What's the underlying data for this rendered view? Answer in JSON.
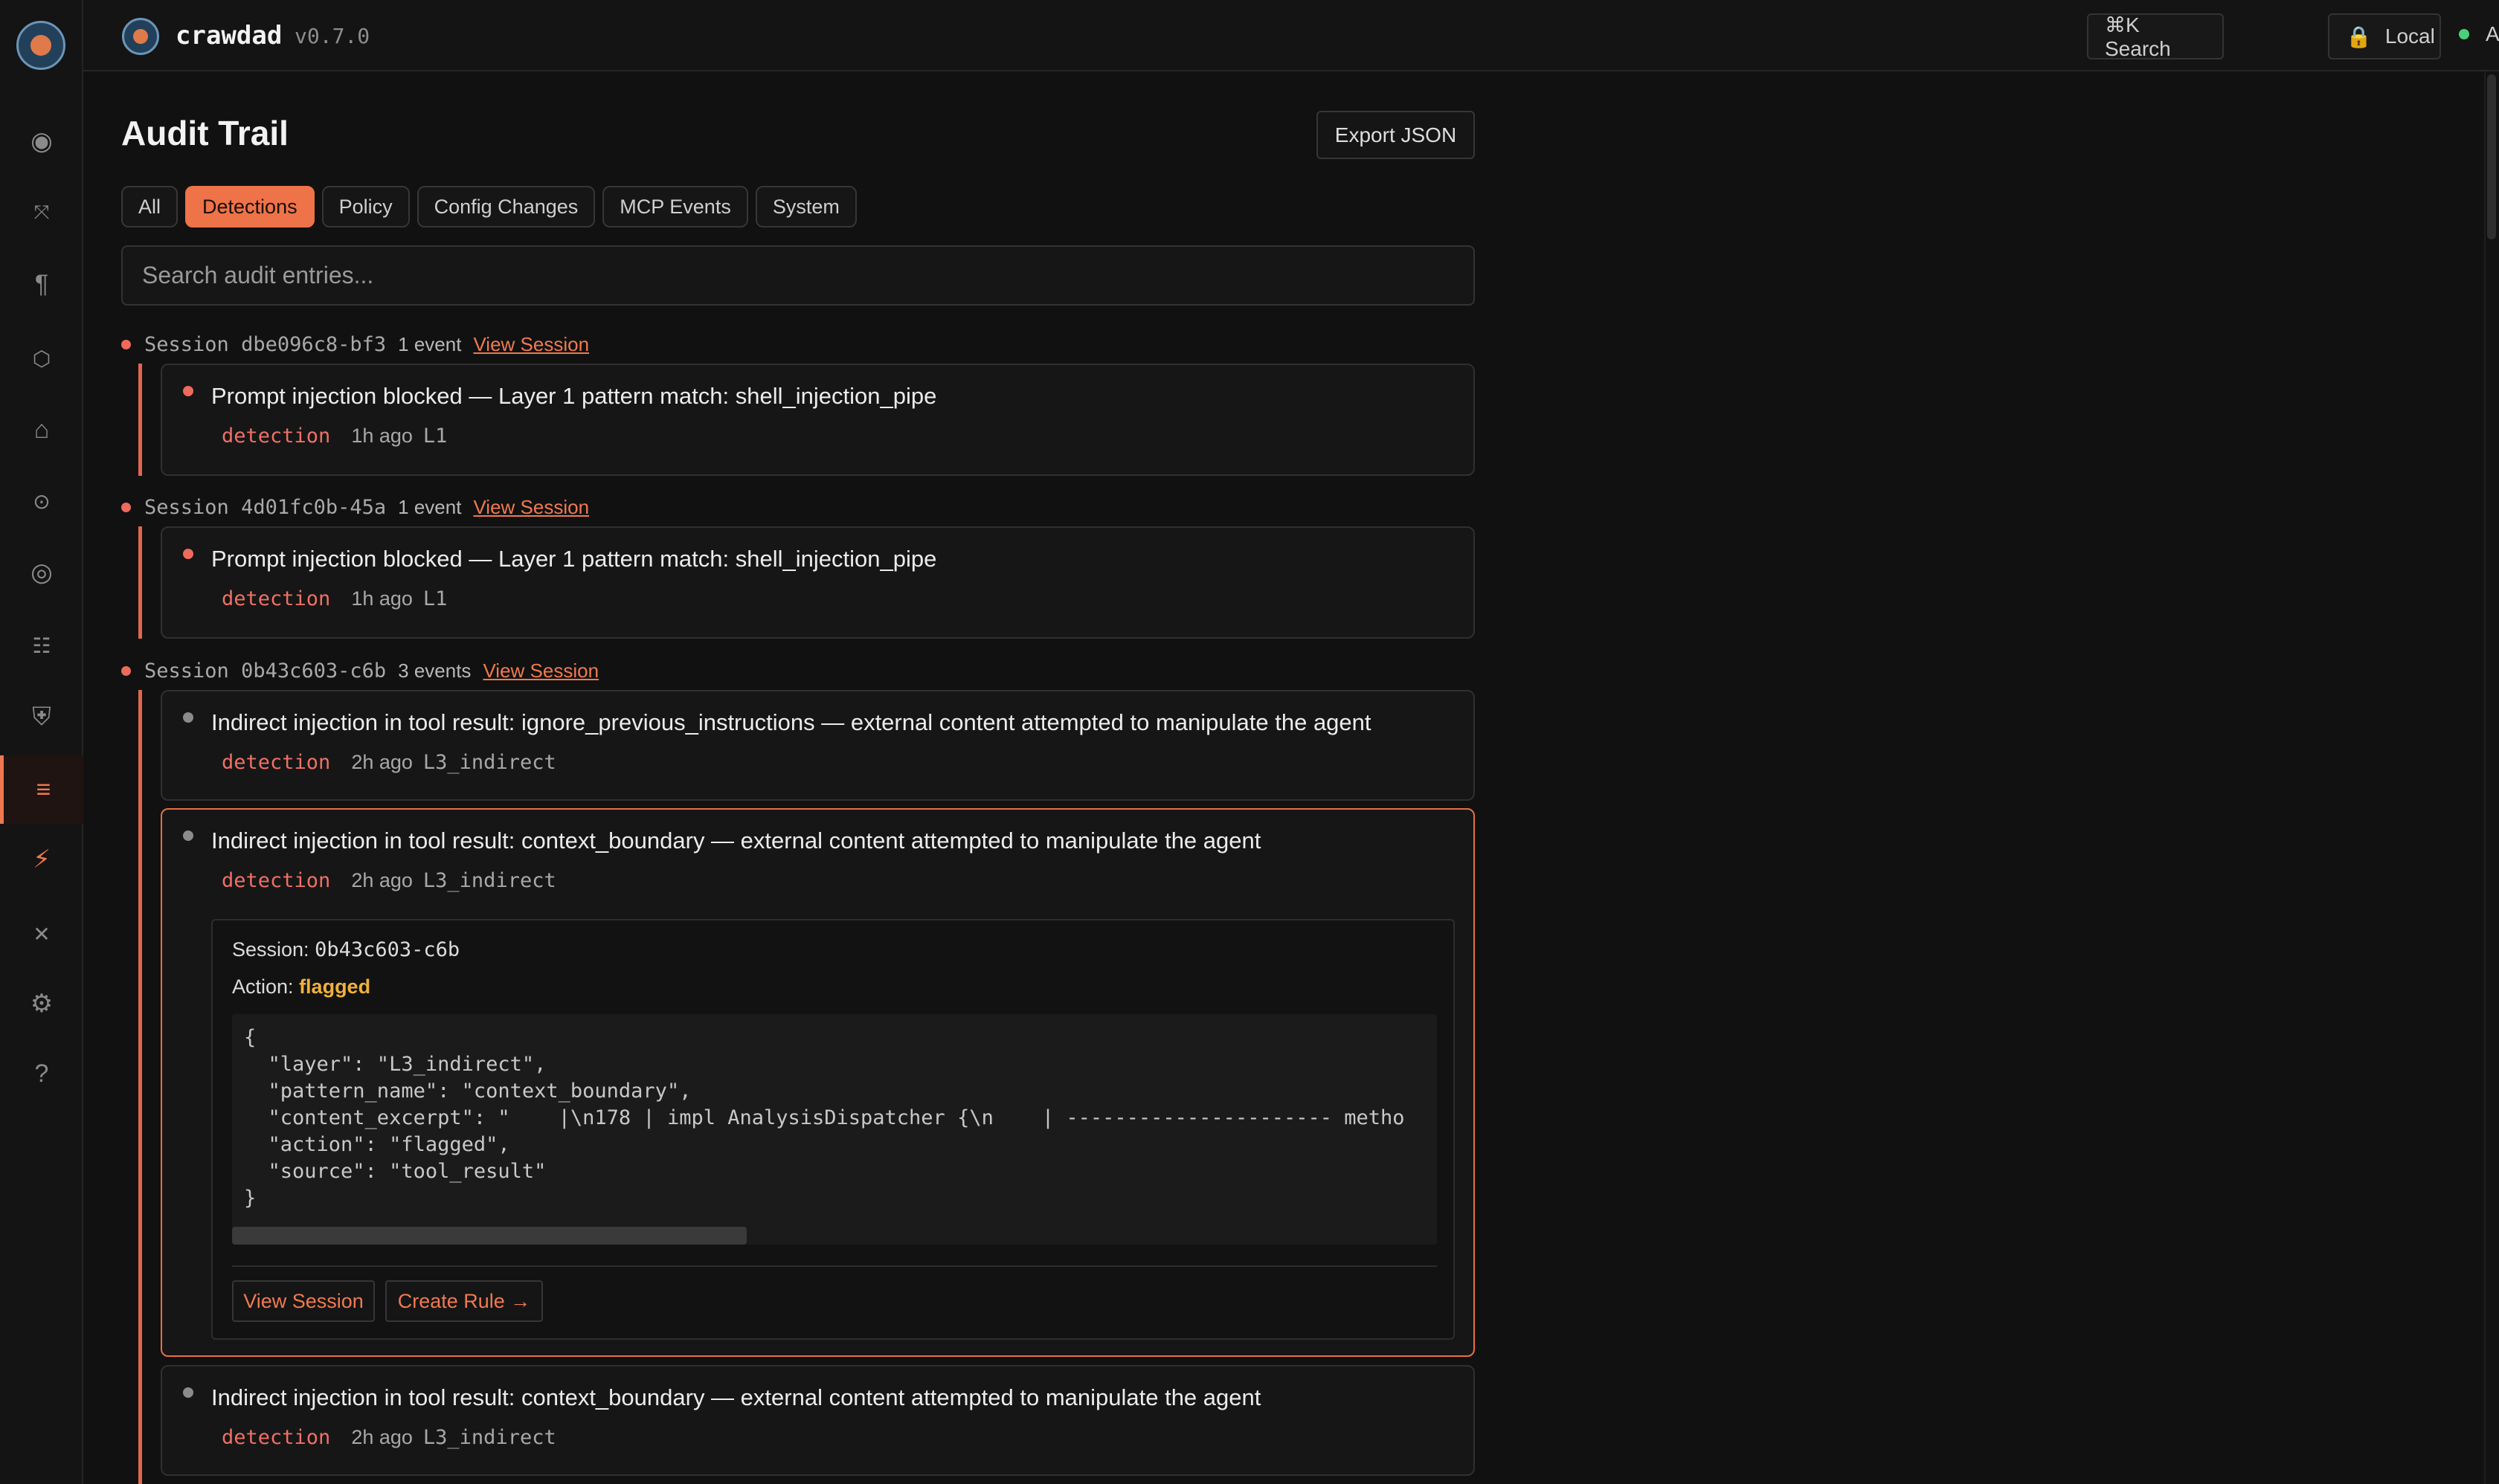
{
  "app": {
    "name": "crawdad",
    "version": "v0.7.0"
  },
  "topbar": {
    "search_label": "⌘K Search",
    "local_label": "Local",
    "status_label": "Active"
  },
  "sidebar": {
    "items": [
      {
        "name": "dashboard",
        "icon": "◉"
      },
      {
        "name": "tools",
        "icon": "⤧"
      },
      {
        "name": "rules",
        "icon": "¶"
      },
      {
        "name": "network",
        "icon": "⬡"
      },
      {
        "name": "home",
        "icon": "⌂"
      },
      {
        "name": "monitor",
        "icon": "⊙"
      },
      {
        "name": "scan",
        "icon": "◎"
      },
      {
        "name": "grid",
        "icon": "☷"
      },
      {
        "name": "shield",
        "icon": "⛨"
      },
      {
        "name": "audit",
        "icon": "≡"
      },
      {
        "name": "bolt",
        "icon": "⚡"
      },
      {
        "name": "close",
        "icon": "✕"
      },
      {
        "name": "settings",
        "icon": "⚙"
      },
      {
        "name": "help",
        "icon": "?"
      }
    ]
  },
  "page": {
    "title": "Audit Trail",
    "export_label": "Export JSON"
  },
  "tabs": [
    "All",
    "Detections",
    "Policy",
    "Config Changes",
    "MCP Events",
    "System"
  ],
  "active_tab": "Detections",
  "search": {
    "placeholder": "Search audit entries..."
  },
  "sessions": [
    {
      "label": "Session",
      "id": "dbe096c8-bf3",
      "count": "1 event",
      "link": "View Session",
      "entries": [
        {
          "title": "Prompt injection blocked — Layer 1 pattern match: shell_injection_pipe",
          "type": "detection",
          "time": "1h ago",
          "layer": "L1"
        }
      ]
    },
    {
      "label": "Session",
      "id": "4d01fc0b-45a",
      "count": "1 event",
      "link": "View Session",
      "entries": [
        {
          "title": "Prompt injection blocked — Layer 1 pattern match: shell_injection_pipe",
          "type": "detection",
          "time": "1h ago",
          "layer": "L1"
        }
      ]
    },
    {
      "label": "Session",
      "id": "0b43c603-c6b",
      "count": "3 events",
      "link": "View Session",
      "entries": [
        {
          "title": "Indirect injection in tool result: ignore_previous_instructions — external content attempted to manipulate the agent",
          "type": "detection",
          "time": "2h ago",
          "layer": "L3_indirect"
        },
        {
          "title": "Indirect injection in tool result: context_boundary — external content attempted to manipulate the agent",
          "type": "detection",
          "time": "2h ago",
          "layer": "L3_indirect"
        },
        {
          "title": "Indirect injection in tool result: context_boundary — external content attempted to manipulate the agent",
          "type": "detection",
          "time": "2h ago",
          "layer": "L3_indirect"
        }
      ]
    }
  ],
  "detail": {
    "session_label": "Session:",
    "session_value": "0b43c603-c6b",
    "action_label": "Action:",
    "action_value": "flagged",
    "json_text": "{\n  \"layer\": \"L3_indirect\",\n  \"pattern_name\": \"context_boundary\",\n  \"content_excerpt\": \"    |\\n178 | impl AnalysisDispatcher {\\n    | ---------------------- metho\n  \"action\": \"flagged\",\n  \"source\": \"tool_result\"\n}",
    "view_session_label": "View Session",
    "create_rule_label": "Create Rule →"
  },
  "colors": {
    "accent": "#ee7348",
    "detection": "#ef7066",
    "flagged": "#f0b13a",
    "status_ok": "#4ad07a"
  }
}
